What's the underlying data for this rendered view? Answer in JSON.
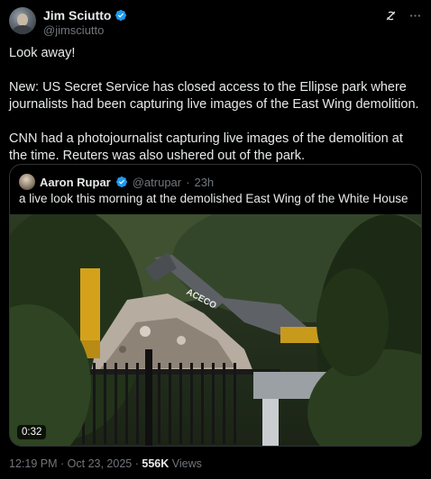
{
  "author": {
    "display_name": "Jim Sciutto",
    "handle": "@jimsciutto"
  },
  "tweet": {
    "paragraphs": [
      "Look away!",
      "New: US Secret Service has closed access to the Ellipse park where journalists had been capturing live images of the East Wing demolition.",
      "CNN had a photojournalist capturing live images of the demolition at the time. Reuters was also ushered out of the park."
    ]
  },
  "quote": {
    "display_name": "Aaron Rupar",
    "handle": "@atrupar",
    "separator": "·",
    "time": "23h",
    "text": "a live look this morning at the demolished East Wing of the White House",
    "video_duration": "0:32",
    "excavator_brand": "ACECO"
  },
  "meta": {
    "time": "12:19 PM",
    "separator": "·",
    "date": "Oct 23, 2025",
    "separator2": "·",
    "views_count": "556K",
    "views_label": "Views"
  },
  "colors": {
    "background": "#000000",
    "text_primary": "#e7e9ea",
    "text_secondary": "#71767b",
    "verified_blue": "#1d9bf0",
    "border": "#2f3336"
  },
  "icons": {
    "verified": "verified-badge-icon",
    "grok": "grok-icon",
    "more": "more-icon"
  }
}
